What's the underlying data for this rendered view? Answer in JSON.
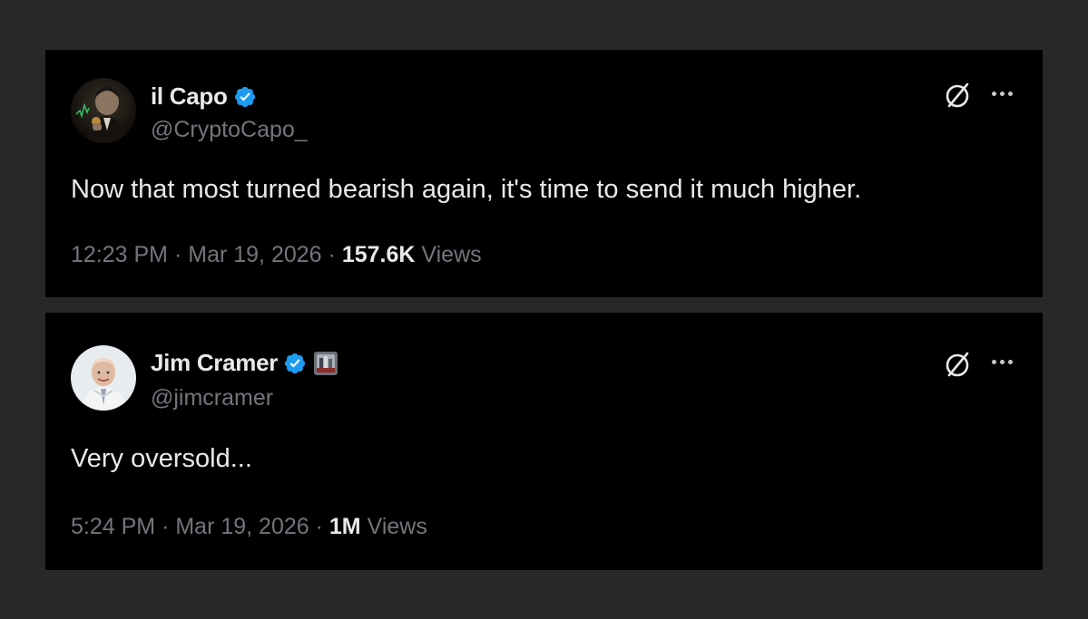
{
  "tweets": [
    {
      "name": "il Capo",
      "handle": "@CryptoCapo_",
      "text": "Now that most turned bearish again, it's time to send it much higher.",
      "time": "12:23 PM",
      "date": "Mar 19, 2026",
      "views_count": "157.6K",
      "views_label": "Views",
      "verified": true,
      "avatar_icon": "mafia-boss-avatar",
      "colors": {
        "verified": "#1d9bf0"
      }
    },
    {
      "name": "Jim Cramer",
      "handle": "@jimcramer",
      "text": "Very oversold...",
      "time": "5:24 PM",
      "date": "Mar 19, 2026",
      "views_count": "1M",
      "views_label": "Views",
      "verified": true,
      "affiliate_badge": "building-badge-icon",
      "avatar_icon": "jim-cramer-avatar",
      "colors": {
        "verified": "#1d9bf0"
      }
    }
  ],
  "separator": "·"
}
